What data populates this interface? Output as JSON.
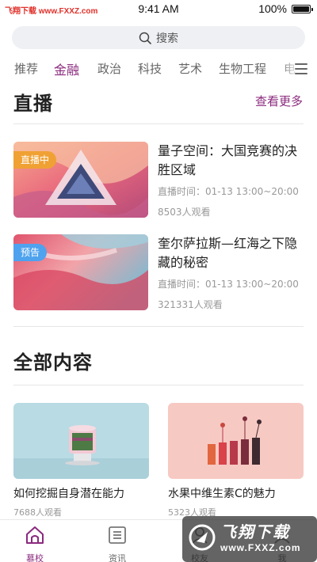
{
  "status_bar": {
    "watermark": "飞翔下载 www.FXXZ.com",
    "time": "9:41 AM",
    "battery": "100%"
  },
  "search": {
    "placeholder": "搜索"
  },
  "tabs": [
    {
      "label": "推荐",
      "active": false
    },
    {
      "label": "金融",
      "active": true
    },
    {
      "label": "政治",
      "active": false
    },
    {
      "label": "科技",
      "active": false
    },
    {
      "label": "艺术",
      "active": false
    },
    {
      "label": "生物工程",
      "active": false
    },
    {
      "label": "电",
      "active": false
    }
  ],
  "live": {
    "title": "直播",
    "see_more": "查看更多",
    "items": [
      {
        "badge": "直播中",
        "title": "量子空间：大国竞赛的决胜区域",
        "time": "直播时间：01-13 13:00~20:00",
        "views": "8503人观看"
      },
      {
        "badge": "预告",
        "title": "奎尔萨拉斯—红海之下隐藏的秘密",
        "time": "直播时间：01-13 13:00~20:00",
        "views": "321331人观看"
      }
    ]
  },
  "all_content": {
    "title": "全部内容",
    "items": [
      {
        "title": "如何挖掘自身潜在能力",
        "views": "7688人观看"
      },
      {
        "title": "水果中维生素C的魅力",
        "views": "5323人观看"
      }
    ]
  },
  "bottom_nav": [
    {
      "label": "慕校",
      "icon": "home-icon",
      "active": true
    },
    {
      "label": "资讯",
      "icon": "news-icon",
      "active": false
    },
    {
      "label": "校友",
      "icon": "alumni-icon",
      "active": false
    },
    {
      "label": "我",
      "icon": "profile-icon",
      "active": false
    }
  ],
  "site_logo": {
    "text": "飞翔下载",
    "url": "www.FXXZ.com"
  },
  "colors": {
    "accent": "#8b2a7e",
    "live_badge": "#f0a133",
    "preview_badge": "#4ea2ee"
  }
}
